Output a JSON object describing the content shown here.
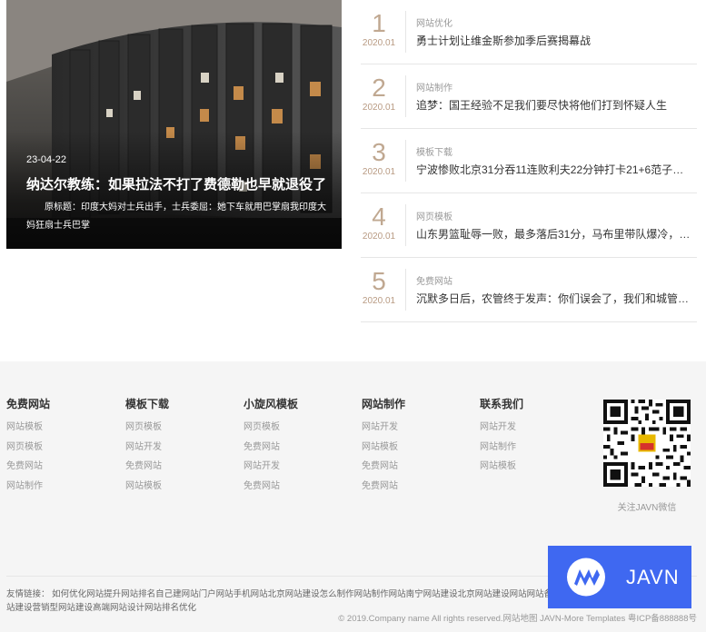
{
  "hero": {
    "date": "23-04-22",
    "title": "纳达尔教练：如果拉法不打了费德勒也早就退役了",
    "summary": "原标题：印度大妈对士兵出手，士兵委屈：她下车就用巴掌扇我印度大妈狂扇士兵巴掌"
  },
  "rank_list": [
    {
      "num": "1",
      "date": "2020.01",
      "category": "网站优化",
      "headline": "勇士计划让维金斯参加季后赛揭幕战"
    },
    {
      "num": "2",
      "date": "2020.01",
      "category": "网站制作",
      "headline": "追梦：国王经验不足我们要尽快将他们打到怀疑人生"
    },
    {
      "num": "3",
      "date": "2020.01",
      "category": "模板下载",
      "headline": "宁波惨败北京31分吞11连败利夫22分钟打卡21+6范子铭砍下12+6"
    },
    {
      "num": "4",
      "date": "2020.01",
      "category": "网页模板",
      "headline": "山东男篮耻辱一败，最多落后31分，马布里带队爆冷，山东已经没希望了"
    },
    {
      "num": "5",
      "date": "2020.01",
      "category": "免费网站",
      "headline": "沉默多日后，农管终于发声：你们误会了，我们和城管不一样"
    }
  ],
  "footer": {
    "columns": [
      {
        "title": "免费网站",
        "links": [
          "网站模板",
          "网页模板",
          "免费网站",
          "网站制作"
        ]
      },
      {
        "title": "模板下载",
        "links": [
          "网页模板",
          "网站开发",
          "免费网站",
          "网站模板"
        ]
      },
      {
        "title": "小旋风模板",
        "links": [
          "网页模板",
          "免费网站",
          "网站开发",
          "免费网站"
        ]
      },
      {
        "title": "网站制作",
        "links": [
          "网站开发",
          "网站模板",
          "免费网站",
          "免费网站"
        ]
      },
      {
        "title": "联系我们",
        "links": [
          "网站开发",
          "网站制作",
          "网站模板"
        ]
      }
    ],
    "qr_caption": "关注JAVN微信",
    "friend_links_label": "友情链接：",
    "friend_links": "如何优化网站提升网站排名自己建网站门户网站手机网站北京网站建设怎么制作网站制作网站南宁网站建设北京网站建设网站网站备案查询北京网站建设申请网站南宁网站建设营销型网站建设高端网站设计网站排名优化",
    "copyright": "© 2019.Company name All rights reserved.网站地图 JAVN-More Templates 粤ICP备888888号"
  },
  "watermark": {
    "text": "JAVN"
  },
  "colors": {
    "accent": "#c0a891",
    "watermark_bg": "#3f68f1"
  }
}
